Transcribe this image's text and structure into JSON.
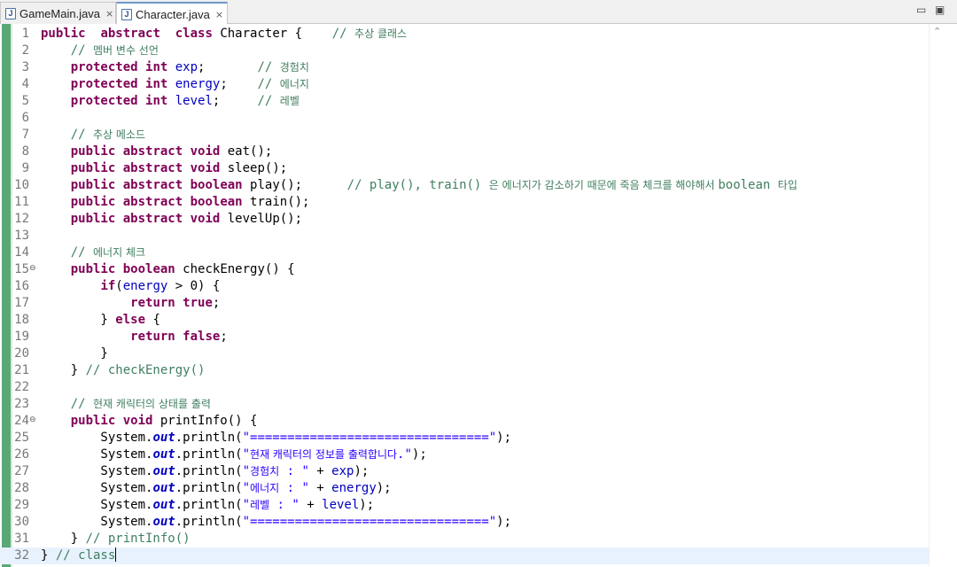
{
  "tabs": [
    {
      "label": "GameMain.java",
      "icon": "java-file-icon",
      "close": "×",
      "active": false
    },
    {
      "label": "Character.java",
      "icon": "java-file-icon",
      "close": "×",
      "active": true
    }
  ],
  "window_controls": {
    "minimize": "▭",
    "maximize": "▣"
  },
  "colors": {
    "keyword": "#7f0055",
    "field": "#0000c0",
    "comment": "#3f7f5f",
    "string": "#2a00ff",
    "gutter": "#5aa778",
    "current_line": "#e8f2fe",
    "active_tab_border": "#6e98c8"
  },
  "editor": {
    "current_line": 32,
    "lines": [
      {
        "n": "1",
        "tokens": [
          [
            "kw",
            "public"
          ],
          [
            "",
            "  "
          ],
          [
            "kw",
            "abstract"
          ],
          [
            "",
            "  "
          ],
          [
            "kw",
            "class"
          ],
          [
            "",
            " Character {    "
          ],
          [
            "cmt",
            "// "
          ],
          [
            "cmtko",
            "추상 클래스"
          ]
        ]
      },
      {
        "n": "2",
        "tokens": [
          [
            "",
            "    "
          ],
          [
            "cmt",
            "// "
          ],
          [
            "cmtko",
            "멤버 변수 선언"
          ]
        ]
      },
      {
        "n": "3",
        "tokens": [
          [
            "",
            "    "
          ],
          [
            "kw",
            "protected"
          ],
          [
            "",
            " "
          ],
          [
            "kw",
            "int"
          ],
          [
            "",
            " "
          ],
          [
            "fld",
            "exp"
          ],
          [
            "",
            ";       "
          ],
          [
            "cmt",
            "// "
          ],
          [
            "cmtko",
            "경험치"
          ]
        ]
      },
      {
        "n": "4",
        "tokens": [
          [
            "",
            "    "
          ],
          [
            "kw",
            "protected"
          ],
          [
            "",
            " "
          ],
          [
            "kw",
            "int"
          ],
          [
            "",
            " "
          ],
          [
            "fld",
            "energy"
          ],
          [
            "",
            ";    "
          ],
          [
            "cmt",
            "// "
          ],
          [
            "cmtko",
            "에너지"
          ]
        ]
      },
      {
        "n": "5",
        "tokens": [
          [
            "",
            "    "
          ],
          [
            "kw",
            "protected"
          ],
          [
            "",
            " "
          ],
          [
            "kw",
            "int"
          ],
          [
            "",
            " "
          ],
          [
            "fld",
            "level"
          ],
          [
            "",
            ";     "
          ],
          [
            "cmt",
            "// "
          ],
          [
            "cmtko",
            "레벨"
          ]
        ]
      },
      {
        "n": "6",
        "tokens": []
      },
      {
        "n": "7",
        "tokens": [
          [
            "",
            "    "
          ],
          [
            "cmt",
            "// "
          ],
          [
            "cmtko",
            "추상 메소드"
          ]
        ]
      },
      {
        "n": "8",
        "tokens": [
          [
            "",
            "    "
          ],
          [
            "kw",
            "public"
          ],
          [
            "",
            " "
          ],
          [
            "kw",
            "abstract"
          ],
          [
            "",
            " "
          ],
          [
            "kw",
            "void"
          ],
          [
            "",
            " eat();"
          ]
        ]
      },
      {
        "n": "9",
        "tokens": [
          [
            "",
            "    "
          ],
          [
            "kw",
            "public"
          ],
          [
            "",
            " "
          ],
          [
            "kw",
            "abstract"
          ],
          [
            "",
            " "
          ],
          [
            "kw",
            "void"
          ],
          [
            "",
            " sleep();"
          ]
        ]
      },
      {
        "n": "10",
        "tokens": [
          [
            "",
            "    "
          ],
          [
            "kw",
            "public"
          ],
          [
            "",
            " "
          ],
          [
            "kw",
            "abstract"
          ],
          [
            "",
            " "
          ],
          [
            "kw",
            "boolean"
          ],
          [
            "",
            " play();      "
          ],
          [
            "cmt",
            "// play(), train() "
          ],
          [
            "cmtko",
            "은 에너지가 감소하기 때문에 죽음 체크를 해야해서 "
          ],
          [
            "cmt",
            "boolean "
          ],
          [
            "cmtko",
            "타입"
          ]
        ]
      },
      {
        "n": "11",
        "tokens": [
          [
            "",
            "    "
          ],
          [
            "kw",
            "public"
          ],
          [
            "",
            " "
          ],
          [
            "kw",
            "abstract"
          ],
          [
            "",
            " "
          ],
          [
            "kw",
            "boolean"
          ],
          [
            "",
            " train();"
          ]
        ]
      },
      {
        "n": "12",
        "tokens": [
          [
            "",
            "    "
          ],
          [
            "kw",
            "public"
          ],
          [
            "",
            " "
          ],
          [
            "kw",
            "abstract"
          ],
          [
            "",
            " "
          ],
          [
            "kw",
            "void"
          ],
          [
            "",
            " levelUp();"
          ]
        ]
      },
      {
        "n": "13",
        "tokens": []
      },
      {
        "n": "14",
        "tokens": [
          [
            "",
            "    "
          ],
          [
            "cmt",
            "// "
          ],
          [
            "cmtko",
            "에너지 체크"
          ]
        ]
      },
      {
        "n": "15",
        "fold": "⊖",
        "tokens": [
          [
            "",
            "    "
          ],
          [
            "kw",
            "public"
          ],
          [
            "",
            " "
          ],
          [
            "kw",
            "boolean"
          ],
          [
            "",
            " checkEnergy() {"
          ]
        ]
      },
      {
        "n": "16",
        "tokens": [
          [
            "",
            "        "
          ],
          [
            "kw",
            "if"
          ],
          [
            "",
            "("
          ],
          [
            "fld",
            "energy"
          ],
          [
            "",
            " > 0) {"
          ]
        ]
      },
      {
        "n": "17",
        "tokens": [
          [
            "",
            "            "
          ],
          [
            "kw",
            "return"
          ],
          [
            "",
            " "
          ],
          [
            "kw",
            "true"
          ],
          [
            "",
            ";"
          ]
        ]
      },
      {
        "n": "18",
        "tokens": [
          [
            "",
            "        } "
          ],
          [
            "kw",
            "else"
          ],
          [
            "",
            " {"
          ]
        ]
      },
      {
        "n": "19",
        "tokens": [
          [
            "",
            "            "
          ],
          [
            "kw",
            "return"
          ],
          [
            "",
            " "
          ],
          [
            "kw",
            "false"
          ],
          [
            "",
            ";"
          ]
        ]
      },
      {
        "n": "20",
        "tokens": [
          [
            "",
            "        }"
          ]
        ]
      },
      {
        "n": "21",
        "tokens": [
          [
            "",
            "    } "
          ],
          [
            "cmt",
            "// checkEnergy()"
          ]
        ]
      },
      {
        "n": "22",
        "tokens": []
      },
      {
        "n": "23",
        "tokens": [
          [
            "",
            "    "
          ],
          [
            "cmt",
            "// "
          ],
          [
            "cmtko",
            "현재 캐릭터의 상태를 출력"
          ]
        ]
      },
      {
        "n": "24",
        "fold": "⊖",
        "tokens": [
          [
            "",
            "    "
          ],
          [
            "kw",
            "public"
          ],
          [
            "",
            " "
          ],
          [
            "kw",
            "void"
          ],
          [
            "",
            " printInfo() {"
          ]
        ]
      },
      {
        "n": "25",
        "tokens": [
          [
            "",
            "        System."
          ],
          [
            "st",
            "out"
          ],
          [
            "",
            ".println("
          ],
          [
            "str",
            "\"================================\""
          ],
          [
            "",
            ");"
          ]
        ]
      },
      {
        "n": "26",
        "tokens": [
          [
            "",
            "        System."
          ],
          [
            "st",
            "out"
          ],
          [
            "",
            ".println("
          ],
          [
            "str",
            "\""
          ],
          [
            "strko",
            "현재 캐릭터의 정보를 출력합니다"
          ],
          [
            "str",
            ".\""
          ],
          [
            "",
            ");"
          ]
        ]
      },
      {
        "n": "27",
        "tokens": [
          [
            "",
            "        System."
          ],
          [
            "st",
            "out"
          ],
          [
            "",
            ".println("
          ],
          [
            "str",
            "\""
          ],
          [
            "strko",
            "경험치"
          ],
          [
            "str",
            " : \""
          ],
          [
            "",
            " + "
          ],
          [
            "fld",
            "exp"
          ],
          [
            "",
            ");"
          ]
        ]
      },
      {
        "n": "28",
        "tokens": [
          [
            "",
            "        System."
          ],
          [
            "st",
            "out"
          ],
          [
            "",
            ".println("
          ],
          [
            "str",
            "\""
          ],
          [
            "strko",
            "에너지"
          ],
          [
            "str",
            " : \""
          ],
          [
            "",
            " + "
          ],
          [
            "fld",
            "energy"
          ],
          [
            "",
            ");"
          ]
        ]
      },
      {
        "n": "29",
        "tokens": [
          [
            "",
            "        System."
          ],
          [
            "st",
            "out"
          ],
          [
            "",
            ".println("
          ],
          [
            "str",
            "\""
          ],
          [
            "strko",
            "레벨"
          ],
          [
            "str",
            " : \""
          ],
          [
            "",
            " + "
          ],
          [
            "fld",
            "level"
          ],
          [
            "",
            ");"
          ]
        ]
      },
      {
        "n": "30",
        "tokens": [
          [
            "",
            "        System."
          ],
          [
            "st",
            "out"
          ],
          [
            "",
            ".println("
          ],
          [
            "str",
            "\"================================\""
          ],
          [
            "",
            ");"
          ]
        ]
      },
      {
        "n": "31",
        "tokens": [
          [
            "",
            "    } "
          ],
          [
            "cmt",
            "// printInfo()"
          ]
        ]
      },
      {
        "n": "32",
        "caret": true,
        "tokens": [
          [
            "",
            "} "
          ],
          [
            "cmt",
            "// class"
          ]
        ]
      }
    ]
  }
}
